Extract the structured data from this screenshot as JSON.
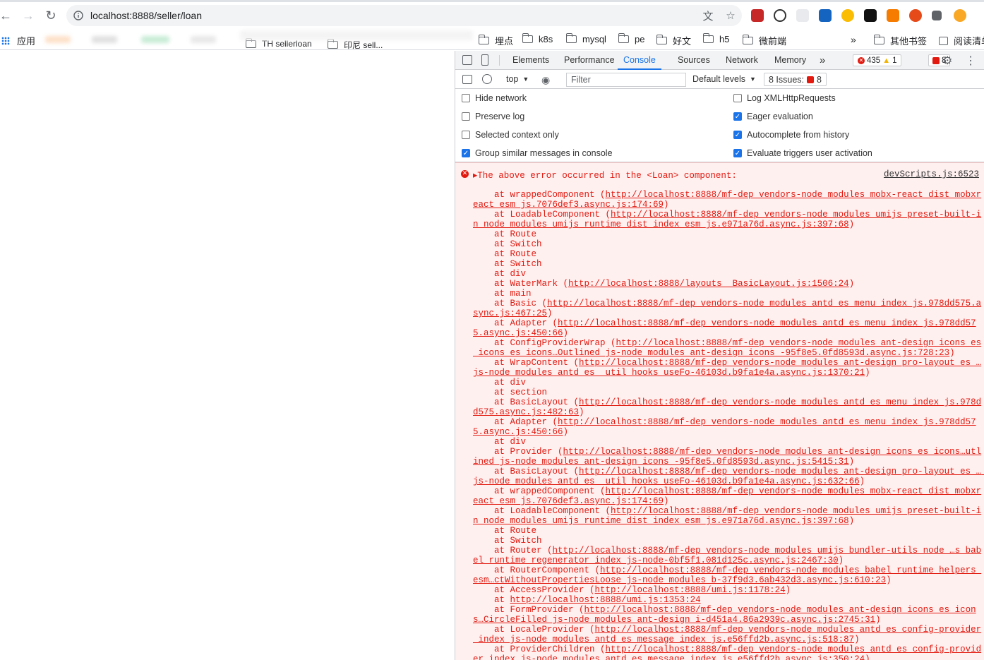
{
  "browser": {
    "url": "localhost:8888/seller/loan"
  },
  "bookmarks": {
    "apps_label": "应用",
    "partial": [
      "TH sellerloan",
      "印尼 sell..."
    ],
    "folders": [
      "埋点",
      "k8s",
      "mysql",
      "pe",
      "好文",
      "h5",
      "微前端"
    ],
    "other": "其他书签",
    "reading": "阅读清单"
  },
  "devtools": {
    "tabs": [
      "Elements",
      "Performance",
      "Console",
      "Sources",
      "Network",
      "Memory"
    ],
    "more": "»",
    "errors_count": "435",
    "warnings_count": "1",
    "issues_badge": "8",
    "context": "top",
    "filter_placeholder": "Filter",
    "levels": "Default levels",
    "issues_label": "8 Issues:",
    "issues_count": "8",
    "settings": {
      "left": [
        {
          "label": "Hide network",
          "checked": false
        },
        {
          "label": "Preserve log",
          "checked": false
        },
        {
          "label": "Selected context only",
          "checked": false
        },
        {
          "label": "Group similar messages in console",
          "checked": true
        }
      ],
      "right": [
        {
          "label": "Log XMLHttpRequests",
          "checked": false
        },
        {
          "label": "Eager evaluation",
          "checked": true
        },
        {
          "label": "Autocomplete from history",
          "checked": true
        },
        {
          "label": "Evaluate triggers user activation",
          "checked": true
        }
      ]
    },
    "console": {
      "error_message": "▸The above error occurred in the <Loan> component:",
      "error_source": "devScripts.js:6523",
      "stack": [
        {
          "prefix": "    at wrappedComponent (",
          "link": "http://localhost:8888/mf-dep_vendors-node_modules_mobx-react_dist_mobxreact_esm_js.7076def3.async.js:174:69",
          "suffix": ")"
        },
        {
          "prefix": "    at LoadableComponent (",
          "link": "http://localhost:8888/mf-dep_vendors-node_modules_umijs_preset-built-in_node_modules_umijs_runtime_dist_index_esm_js.e971a76d.async.js:397:68",
          "suffix": ")"
        },
        {
          "prefix": "    at Route",
          "link": "",
          "suffix": ""
        },
        {
          "prefix": "    at Switch",
          "link": "",
          "suffix": ""
        },
        {
          "prefix": "    at Route",
          "link": "",
          "suffix": ""
        },
        {
          "prefix": "    at Switch",
          "link": "",
          "suffix": ""
        },
        {
          "prefix": "    at div",
          "link": "",
          "suffix": ""
        },
        {
          "prefix": "    at WaterMark (",
          "link": "http://localhost:8888/layouts__BasicLayout.js:1506:24",
          "suffix": ")"
        },
        {
          "prefix": "    at main",
          "link": "",
          "suffix": ""
        },
        {
          "prefix": "    at Basic (",
          "link": "http://localhost:8888/mf-dep_vendors-node_modules_antd_es_menu_index_js.978dd575.async.js:467:25",
          "suffix": ")"
        },
        {
          "prefix": "    at Adapter (",
          "link": "http://localhost:8888/mf-dep_vendors-node_modules_antd_es_menu_index_js.978dd575.async.js:450:66",
          "suffix": ")"
        },
        {
          "prefix": "    at ConfigProviderWrap (",
          "link": "http://localhost:8888/mf-dep_vendors-node_modules_ant-design_icons_es_icons_es_icons…Outlined_js-node_modules_ant-design_icons_-95f8e5.0fd8593d.async.js:728:23",
          "suffix": ")"
        },
        {
          "prefix": "    at WrapContent (",
          "link": "http://localhost:8888/mf-dep_vendors-node_modules_ant-design_pro-layout_es_…js-node_modules_antd_es__util_hooks_useFo-46103d.b9fa1e4a.async.js:1370:21",
          "suffix": ")"
        },
        {
          "prefix": "    at div",
          "link": "",
          "suffix": ""
        },
        {
          "prefix": "    at section",
          "link": "",
          "suffix": ""
        },
        {
          "prefix": "    at BasicLayout (",
          "link": "http://localhost:8888/mf-dep_vendors-node_modules_antd_es_menu_index_js.978dd575.async.js:482:63",
          "suffix": ")"
        },
        {
          "prefix": "    at Adapter (",
          "link": "http://localhost:8888/mf-dep_vendors-node_modules_antd_es_menu_index_js.978dd575.async.js:450:66",
          "suffix": ")"
        },
        {
          "prefix": "    at div",
          "link": "",
          "suffix": ""
        },
        {
          "prefix": "    at Provider (",
          "link": "http://localhost:8888/mf-dep_vendors-node_modules_ant-design_icons_es_icons…utlined_js-node_modules_ant-design_icons_-95f8e5.0fd8593d.async.js:5415:31",
          "suffix": ")"
        },
        {
          "prefix": "    at BasicLayout (",
          "link": "http://localhost:8888/mf-dep_vendors-node_modules_ant-design_pro-layout_es_… js-node_modules_antd_es__util_hooks_useFo-46103d.b9fa1e4a.async.js:632:66",
          "suffix": ")"
        },
        {
          "prefix": "    at wrappedComponent (",
          "link": "http://localhost:8888/mf-dep_vendors-node_modules_mobx-react_dist_mobxreact_esm_js.7076def3.async.js:174:69",
          "suffix": ")"
        },
        {
          "prefix": "    at LoadableComponent (",
          "link": "http://localhost:8888/mf-dep_vendors-node_modules_umijs_preset-built-in_node_modules_umijs_runtime_dist_index_esm_js.e971a76d.async.js:397:68",
          "suffix": ")"
        },
        {
          "prefix": "    at Route",
          "link": "",
          "suffix": ""
        },
        {
          "prefix": "    at Switch",
          "link": "",
          "suffix": ""
        },
        {
          "prefix": "    at Router (",
          "link": "http://localhost:8888/mf-dep_vendors-node_modules_umijs_bundler-utils_node_…s_babel_runtime_regenerator_index_js-node-0bf5f1.081d125c.async.js:2467:30",
          "suffix": ")"
        },
        {
          "prefix": "    at RouterComponent (",
          "link": "http://localhost:8888/mf-dep_vendors-node_modules_babel_runtime_helpers_esm…ctWithoutPropertiesLoose_js-node_modules_b-37f9d3.6ab432d3.async.js:610:23",
          "suffix": ")"
        },
        {
          "prefix": "    at AccessProvider (",
          "link": "http://localhost:8888/umi.js:1178:24",
          "suffix": ")"
        },
        {
          "prefix": "    at ",
          "link": "http://localhost:8888/umi.js:1353:24",
          "suffix": ""
        },
        {
          "prefix": "    at FormProvider (",
          "link": "http://localhost:8888/mf-dep_vendors-node_modules_ant-design_icons_es_icons…CircleFilled_js-node_modules_ant-design_i-d451a4.86a2939c.async.js:2745:31",
          "suffix": ")"
        },
        {
          "prefix": "    at LocaleProvider (",
          "link": "http://localhost:8888/mf-dep_vendors-node_modules_antd_es_config-provider_index_js-node_modules_antd_es_message_index_js.e56ffd2b.async.js:518:87",
          "suffix": ")"
        },
        {
          "prefix": "    at ProviderChildren (",
          "link": "http://localhost:8888/mf-dep_vendors-node_modules_antd_es_config-provider_index_js-node_modules_antd_es_message_index_js.e56ffd2b.async.js:350:24",
          "suffix": ")"
        }
      ]
    }
  }
}
